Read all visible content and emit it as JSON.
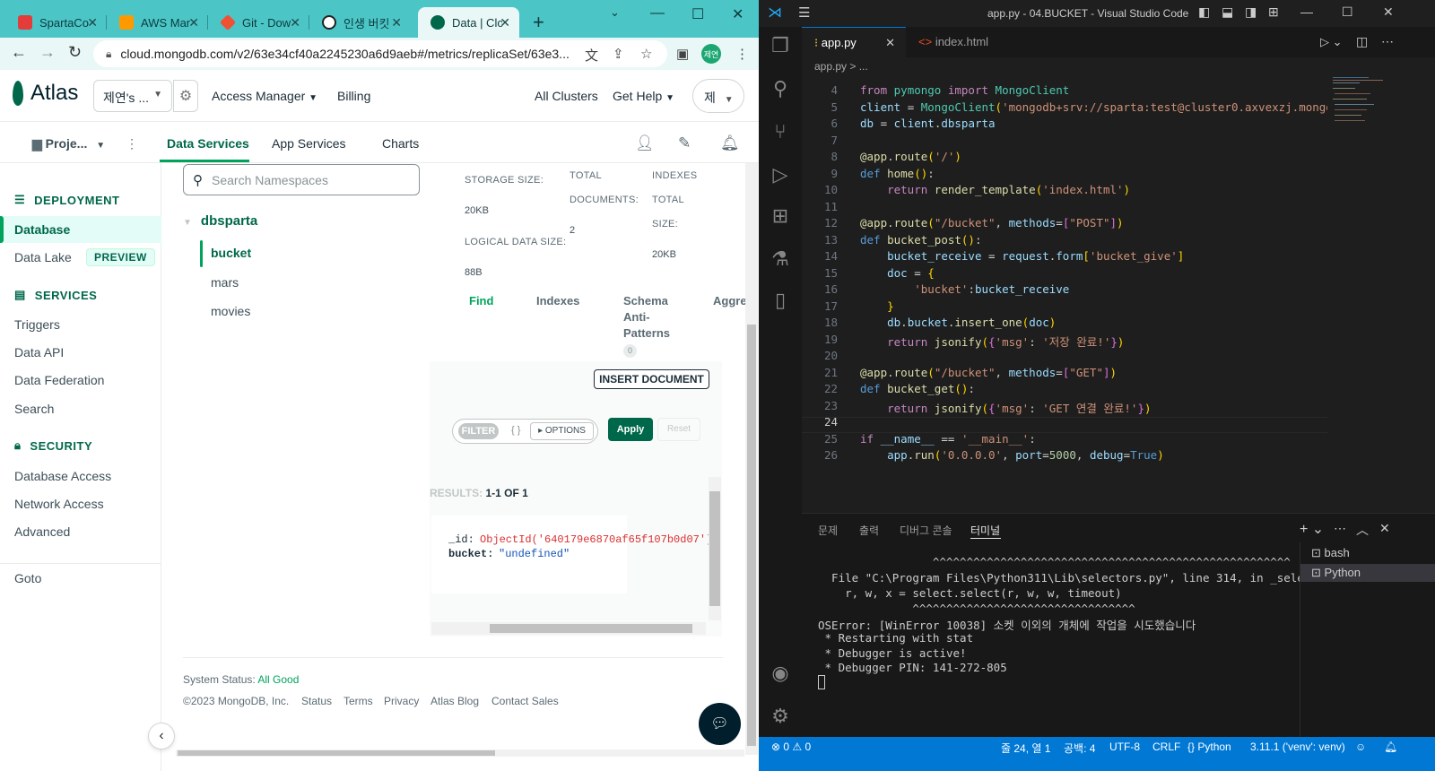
{
  "browser": {
    "tabs": [
      {
        "label": "SpartaCo",
        "color": "#e43b3b"
      },
      {
        "label": "AWS Mar",
        "color": "#f90"
      },
      {
        "label": "Git - Dow",
        "color": "#f05133"
      },
      {
        "label": "인생 버킷",
        "color": "#222"
      },
      {
        "label": "Data | Clo",
        "color": "#00684a"
      }
    ],
    "new_tab": "+",
    "url": "cloud.mongodb.com/v2/63e34cf40a2245230a6d9aeb#/metrics/replicaSet/63e3...",
    "profile_initials": "제연"
  },
  "atlas": {
    "logo_text": "Atlas",
    "org_name": "제연's ...",
    "header_links": [
      "Access Manager",
      "Billing",
      "All Clusters",
      "Get Help"
    ],
    "user_initial": "제",
    "project_name": "Proje...",
    "subtabs": [
      "Data Services",
      "App Services",
      "Charts"
    ],
    "sidebar": {
      "deployment_heading": "DEPLOYMENT",
      "database": "Database",
      "data_lake": "Data Lake",
      "preview_badge": "PREVIEW",
      "services_heading": "SERVICES",
      "services": [
        "Triggers",
        "Data API",
        "Data Federation",
        "Search"
      ],
      "security_heading": "SECURITY",
      "security": [
        "Database Access",
        "Network Access",
        "Advanced"
      ],
      "goto": "Goto"
    },
    "namespace_search_placeholder": "Search Namespaces",
    "database_name": "dbsparta",
    "collections": [
      "bucket",
      "mars",
      "movies"
    ],
    "stats": {
      "storage_size_label": "STORAGE SIZE:",
      "storage_size": "20KB",
      "logical_size_label": "LOGICAL DATA SIZE:",
      "logical_size": "88B",
      "total_docs_label_1": "TOTAL",
      "total_docs_label_2": "DOCUMENTS:",
      "total_docs": "2",
      "indexes_label": "INDEXES",
      "indexes_total_1": "TOTAL",
      "indexes_total_2": "SIZE:",
      "indexes_size": "20KB"
    },
    "doc_tabs": {
      "find": "Find",
      "indexes": "Indexes",
      "schema_1": "Schema",
      "schema_2": "Anti-",
      "schema_3": "Patterns",
      "aggregation": "Aggre",
      "schema_count": "0"
    },
    "insert_document": "INSERT DOCUMENT",
    "filter_label": "FILTER",
    "filter_value": "{ }",
    "options": "▸ OPTIONS",
    "apply": "Apply",
    "reset": "Reset",
    "results_label": "RESULTS:",
    "results_value": "1-1 OF 1",
    "document": {
      "id_key": "_id:",
      "id_value": "ObjectId('640179e6870af65f107b0d07')",
      "bucket_key": "bucket:",
      "bucket_value": "\"undefined\""
    },
    "system_status_label": "System Status:",
    "system_status_value": "All Good",
    "footer_links": [
      "©2023 MongoDB, Inc.",
      "Status",
      "Terms",
      "Privacy",
      "Atlas Blog",
      "Contact Sales"
    ]
  },
  "vscode": {
    "title": "app.py - 04.BUCKET - Visual Studio Code",
    "tabs": [
      "app.py",
      "index.html"
    ],
    "breadcrumb": "app.py > ...",
    "line_numbers": [
      "4",
      "5",
      "6",
      "7",
      "8",
      "9",
      "10",
      "11",
      "12",
      "13",
      "14",
      "15",
      "16",
      "17",
      "18",
      "19",
      "20",
      "21",
      "22",
      "23",
      "24",
      "25",
      "26"
    ],
    "panel_tabs": [
      "문제",
      "출력",
      "디버그 콘솔",
      "터미널"
    ],
    "terminal_lines": [
      "                 ^^^^^^^^^^^^^^^^^^^^^^^^^^^^^^^^^^^^^^^^^^^^^^^^^^^^^",
      "  File \"C:\\Program Files\\Python311\\Lib\\selectors.py\", line 314, in _select",
      "    r, w, x = select.select(r, w, w, timeout)",
      "              ^^^^^^^^^^^^^^^^^^^^^^^^^^^^^^^^^",
      "OSError: [WinError 10038] 소켓 이외의 개체에 작업을 시도했습니다",
      " * Restarting with stat",
      " * Debugger is active!",
      " * Debugger PIN: 141-272-805"
    ],
    "terminals": [
      "bash",
      "Python"
    ],
    "status": {
      "problems": "⊗ 0 ⚠ 0",
      "position": "줄 24, 열 1",
      "spaces": "공백: 4",
      "encoding": "UTF-8",
      "eol": "CRLF",
      "language": "{} Python",
      "interpreter": "3.11.1 ('venv': venv)"
    }
  }
}
